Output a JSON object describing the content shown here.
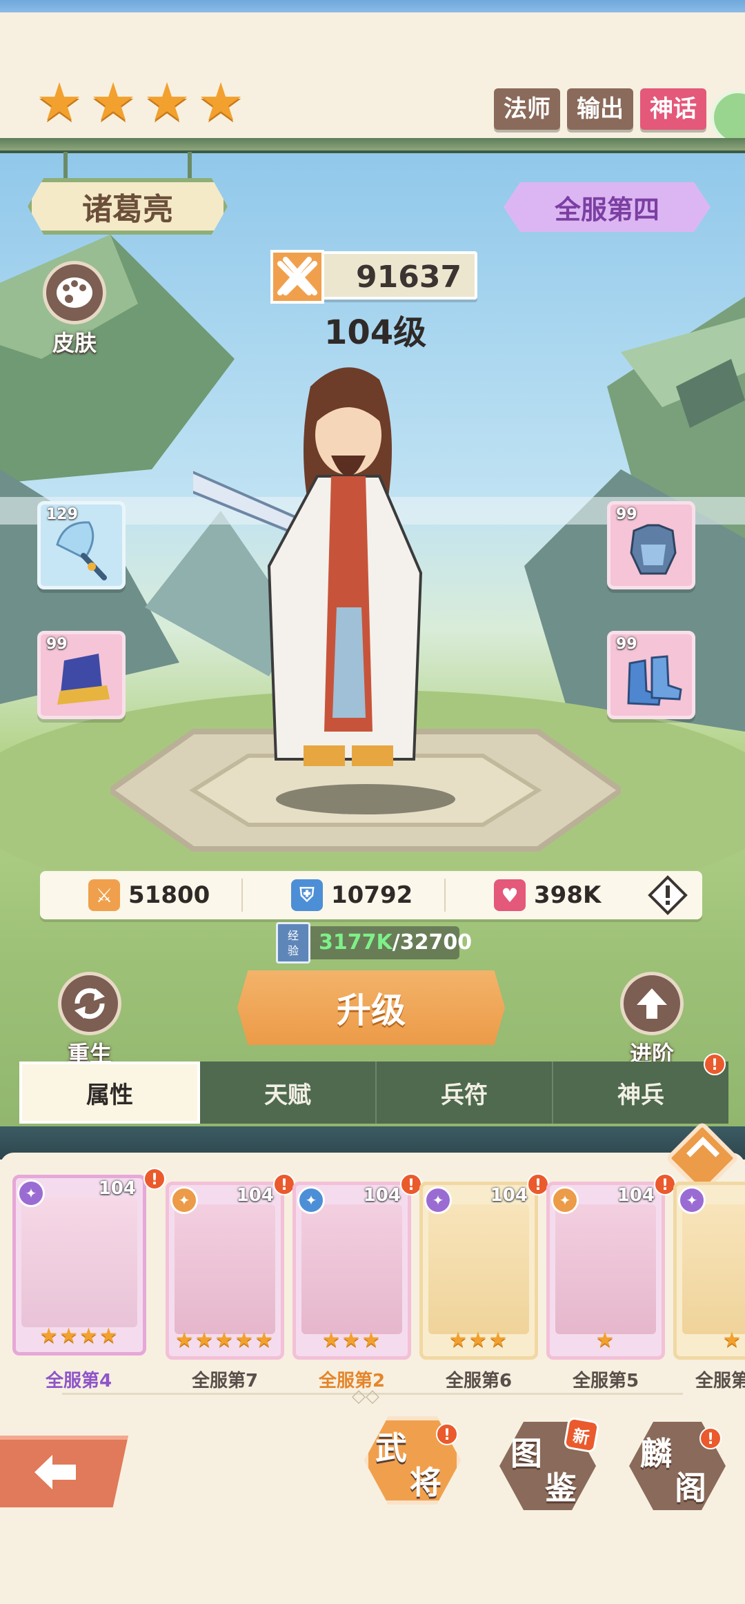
{
  "hero": {
    "star_count": 4,
    "name": "诸葛亮",
    "tags": [
      {
        "label": "法师",
        "color": "#8a6a5a"
      },
      {
        "label": "输出",
        "color": "#8a6a5a"
      },
      {
        "label": "神话",
        "color": "#e4587a"
      }
    ],
    "server_rank": "全服第四",
    "power": "91637",
    "level": "104级",
    "skin_label": "皮肤"
  },
  "equipment": [
    {
      "slot": "weapon",
      "level": "129",
      "icon": "fan-icon"
    },
    {
      "slot": "helmet",
      "level": "99",
      "icon": "hat-icon"
    },
    {
      "slot": "armor",
      "level": "99",
      "icon": "armor-icon"
    },
    {
      "slot": "boots",
      "level": "99",
      "icon": "boots-icon"
    }
  ],
  "stats": {
    "attack": "51800",
    "defense": "10792",
    "hp": "398K"
  },
  "exp": {
    "icon_label_1": "经",
    "icon_label_2": "验",
    "current": "3177K",
    "sep_total": "/32700"
  },
  "actions": {
    "rebirth": "重生",
    "upgrade": "升级",
    "advance": "进阶"
  },
  "tabs": [
    {
      "label": "属性",
      "active": true
    },
    {
      "label": "天赋",
      "active": false
    },
    {
      "label": "兵符",
      "active": false
    },
    {
      "label": "神兵",
      "active": false,
      "badge": "!"
    }
  ],
  "roster": [
    {
      "level": "104",
      "stars": "★★★★",
      "rank": "全服第4",
      "badge": "!"
    },
    {
      "level": "104",
      "stars": "★★★★★",
      "rank": "全服第7",
      "badge": "!"
    },
    {
      "level": "104",
      "stars": "★★★",
      "rank": "全服第2",
      "badge": "!"
    },
    {
      "level": "104",
      "stars": "★★★",
      "rank": "全服第6",
      "badge": "!"
    },
    {
      "level": "104",
      "stars": "★",
      "rank": "全服第5",
      "badge": "!"
    },
    {
      "level": "",
      "stars": "★",
      "rank": "全服第",
      "badge": ""
    }
  ],
  "bottom_nav": {
    "generals_1": "武",
    "generals_2": "将",
    "generals_badge": "!",
    "codex_1": "图",
    "codex_2": "鉴",
    "codex_new": "新",
    "kylin_1": "麟",
    "kylin_2": "阁",
    "kylin_badge": "!"
  }
}
